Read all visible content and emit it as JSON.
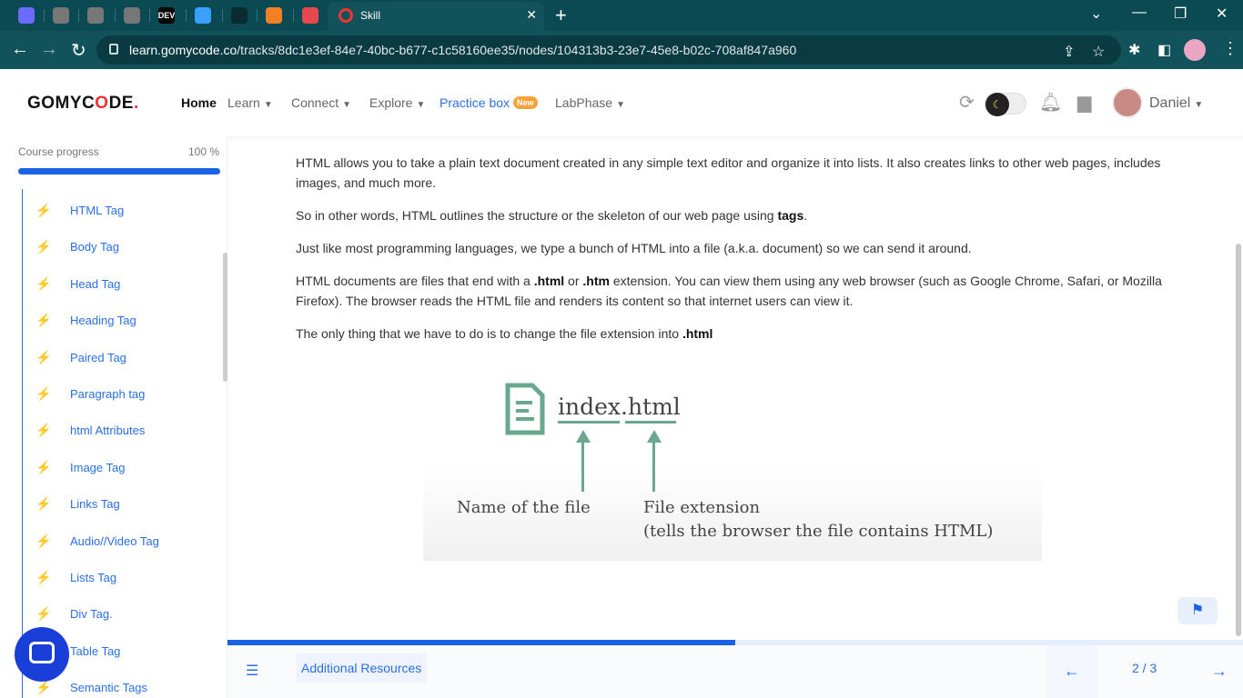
{
  "browser": {
    "active_tab": {
      "title": "Skill"
    },
    "other_tabs": [
      {
        "icon": "app-icon",
        "color": "#6b6bff"
      },
      {
        "icon": "globe-icon",
        "color": "#777777"
      },
      {
        "icon": "globe-icon",
        "color": "#777777"
      },
      {
        "icon": "globe-icon",
        "color": "#777777"
      },
      {
        "icon": "dev-icon",
        "color": "#000000",
        "text": "DEV"
      },
      {
        "icon": "gauge-icon",
        "color": "#3aa0ff"
      },
      {
        "icon": "dark-site-icon",
        "color": "#0b2a30"
      },
      {
        "icon": "stackoverflow-icon",
        "color": "#f48024"
      },
      {
        "icon": "shield-icon",
        "color": "#e5484d"
      }
    ],
    "url_host": "learn.gomycode.co",
    "url_path": "/tracks/8dc1e3ef-84e7-40bc-b677-c1c58160ee35/nodes/104313b3-23e7-45e8-b02c-708af847a960"
  },
  "header": {
    "logo_left": "GOMYC",
    "logo_accent": "O",
    "logo_right": "DE",
    "logo_dot": ".",
    "nav": {
      "home": "Home",
      "learn": "Learn",
      "connect": "Connect",
      "explore": "Explore",
      "practice": "Practice box",
      "practice_badge": "New",
      "labphase": "LabPhase"
    },
    "user": "Daniel"
  },
  "sidebar": {
    "progress_label": "Course progress",
    "progress_value": "100 %",
    "progress_fraction": 1.0,
    "lessons": [
      "HTML Tag",
      "Body Tag",
      "Head Tag",
      "Heading Tag",
      "Paired Tag",
      "Paragraph tag",
      "html Attributes",
      "Image Tag",
      "Links Tag",
      "Audio//Video Tag",
      "Lists Tag",
      "Div Tag.",
      "Table Tag",
      "Semantic Tags"
    ]
  },
  "content": {
    "p1": "HTML allows you to take a plain text document created in any simple text editor and organize it into lists. It also creates links to other web pages, includes images, and much more.",
    "p2_pre": "So in other words, HTML outlines the structure or the skeleton of our web page using ",
    "p2_bold": "tags",
    "p2_post": ".",
    "p3": "Just like most programming languages, we type a bunch of HTML into a file (a.k.a. document) so we can send it around.",
    "p4_a": "HTML documents are files that end with a ",
    "p4_b": ".html",
    "p4_c": " or ",
    "p4_d": ".htm",
    "p4_e": " extension. You can view them using any web browser (such as Google Chrome, Safari, or Mozilla Firefox). The browser reads the HTML file and renders its content so that internet users can view it.",
    "p5_pre": "The only thing that we have to do is to change the file extension into ",
    "p5_bold": ".html",
    "figure": {
      "filename_name": "index",
      "filename_dot": ".",
      "filename_ext": "html",
      "label_name": "Name of the file",
      "label_ext_1": "File extension",
      "label_ext_2": "(tells the browser the file contains HTML)",
      "accent_color": "#6aa88e"
    }
  },
  "footer": {
    "resources": "Additional Resources",
    "page": "2 / 3",
    "lesson_progress_fraction": 0.5
  }
}
